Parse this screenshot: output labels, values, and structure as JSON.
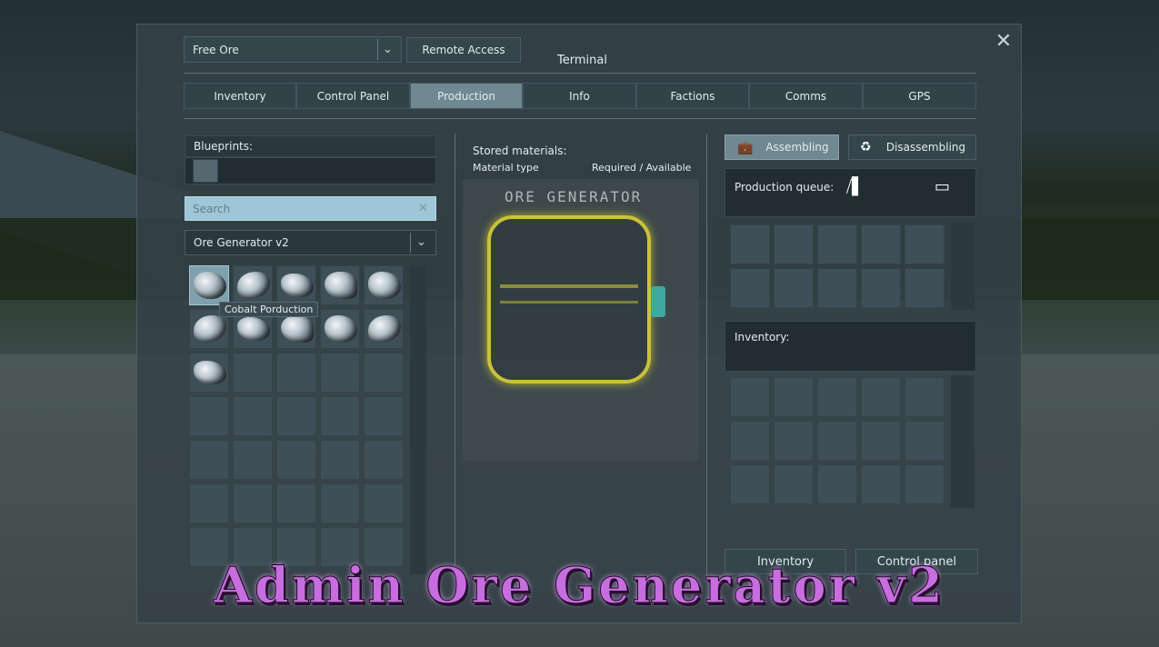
{
  "window": {
    "title": "Terminal",
    "close_icon": "close-icon",
    "block_select": {
      "value": "Free Ore"
    },
    "remote_access_label": "Remote Access"
  },
  "tabs": [
    {
      "label": "Inventory",
      "active": false
    },
    {
      "label": "Control Panel",
      "active": false
    },
    {
      "label": "Production",
      "active": true
    },
    {
      "label": "Info",
      "active": false
    },
    {
      "label": "Factions",
      "active": false
    },
    {
      "label": "Comms",
      "active": false
    },
    {
      "label": "GPS",
      "active": false
    }
  ],
  "left": {
    "blueprints_label": "Blueprints:",
    "search_placeholder": "Search",
    "category_select": {
      "value": "Ore Generator v2"
    },
    "tooltip": "Cobalt Porduction",
    "filled_slots": 11
  },
  "middle": {
    "stored_materials_label": "Stored materials:",
    "material_type_label": "Material type",
    "required_available_label": "Required / Available",
    "device_label": "ORE GENERATOR"
  },
  "right": {
    "assembling_label": "Assembling",
    "disassembling_label": "Disassembling",
    "production_queue_label": "Production queue:",
    "inventory_label": "Inventory:",
    "inventory_button": "Inventory",
    "control_panel_button": "Control panel"
  },
  "banner": {
    "text": "Admin Ore Generator v2"
  },
  "colors": {
    "active_tab": "#6f8891",
    "search_bg": "#9fc6d7",
    "generator_frame": "#c9c23a",
    "banner": "#c86de0"
  }
}
